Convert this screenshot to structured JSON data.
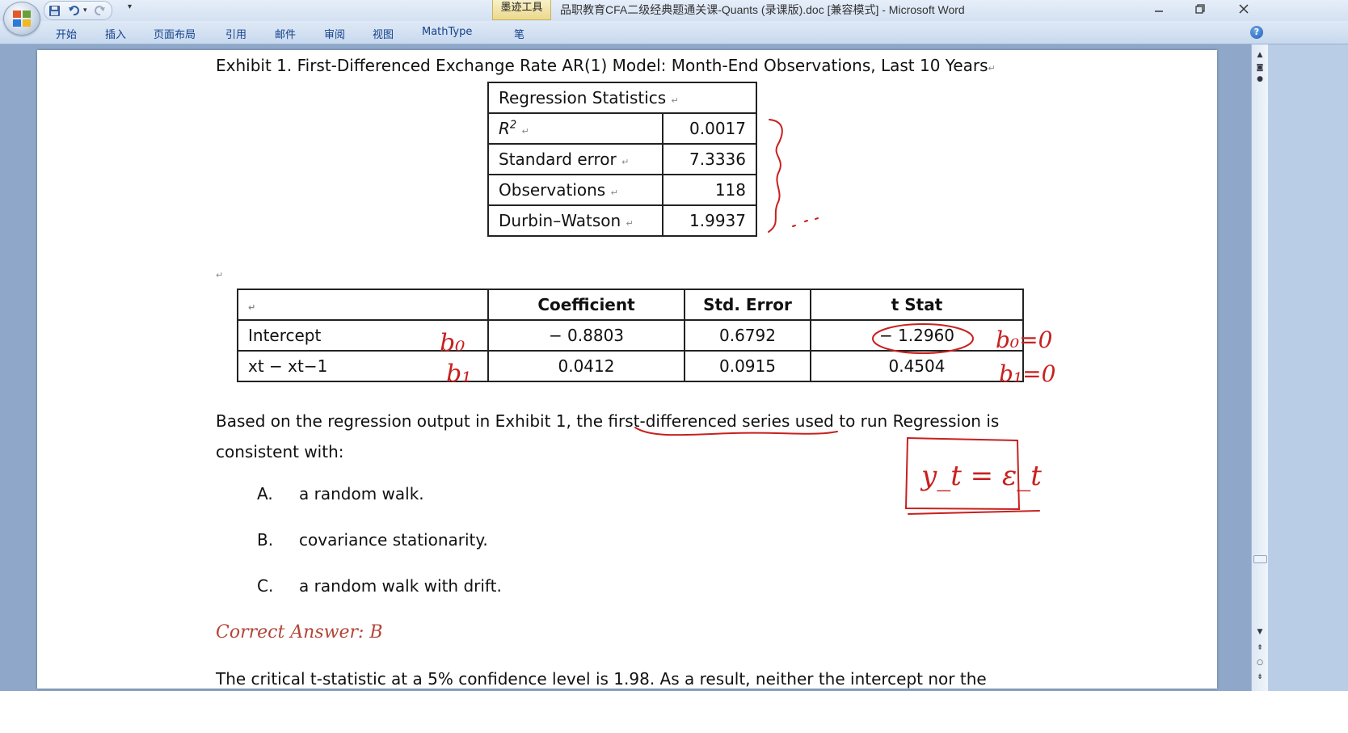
{
  "window": {
    "title": "品职教育CFA二级经典题通关课-Quants (录课版).doc [兼容模式] - Microsoft Word",
    "context_tab": "墨迹工具",
    "min_icon": "minimize-icon",
    "restore_icon": "restore-icon",
    "close_icon": "close-icon"
  },
  "quick_access": {
    "icons": [
      "save-icon",
      "undo-icon",
      "redo-icon",
      "customize-dropdown-icon"
    ]
  },
  "ribbon": {
    "tabs": [
      "开始",
      "插入",
      "页面布局",
      "引用",
      "邮件",
      "审阅",
      "视图",
      "MathType",
      "笔"
    ],
    "help_label": "?"
  },
  "document": {
    "caption": "Exhibit 1. First-Differenced Exchange Rate AR(1) Model: Month-End Observations, Last 10 Years",
    "regression_stats": {
      "header": "Regression Statistics",
      "rows": [
        {
          "label": "R²",
          "value": "0.0017"
        },
        {
          "label": "Standard error",
          "value": "7.3336"
        },
        {
          "label": "Observations",
          "value": "118"
        },
        {
          "label": "Durbin–Watson",
          "value": "1.9937"
        }
      ]
    },
    "coefficients": {
      "headers": [
        "",
        "Coefficient",
        "Std. Error",
        "t Stat"
      ],
      "rows": [
        {
          "name": "Intercept",
          "coef": "− 0.8803",
          "se": "0.6792",
          "t": "− 1.2960"
        },
        {
          "name": "xt − xt−1",
          "coef": "0.0412",
          "se": "0.0915",
          "t": "0.4504"
        }
      ]
    },
    "question": "Based on the regression output in Exhibit 1, the first-differenced series used to run Regression is consistent with:",
    "options": [
      {
        "letter": "A.",
        "text": "a random walk."
      },
      {
        "letter": "B.",
        "text": "covariance stationarity."
      },
      {
        "letter": "C.",
        "text": "a random walk with drift."
      }
    ],
    "answer": "Correct Answer: B",
    "explanation": "The critical t-statistic at a 5% confidence level is 1.98. As a result, neither the intercept nor the"
  },
  "annotations": {
    "b0_label": "b₀",
    "b1_label": "b₁",
    "b0_eq": "b₀=0",
    "b1_eq": "b₁=0",
    "boxed": "y_t = ε_t",
    "ink_color": "#c8201e"
  }
}
